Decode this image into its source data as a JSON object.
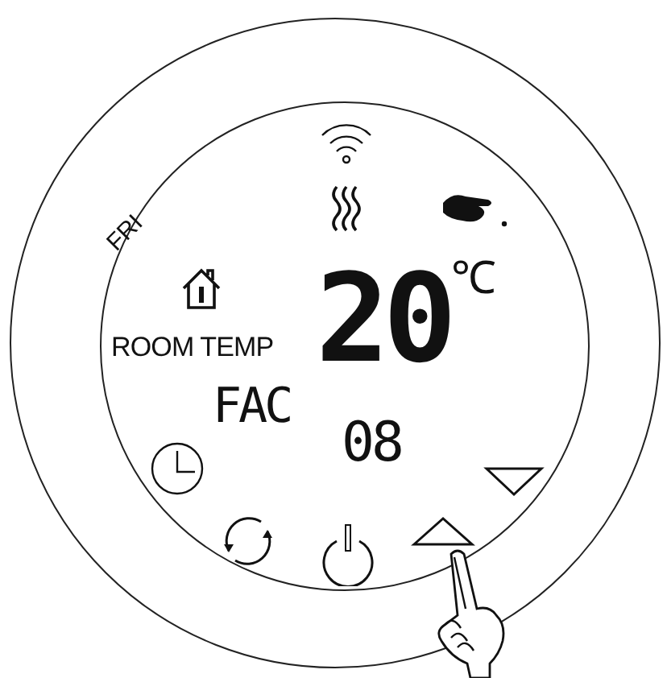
{
  "display": {
    "day": "FRI",
    "room_label": "ROOM TEMP",
    "temperature": "20",
    "unit": "℃",
    "mode": "FAC",
    "value": "08"
  }
}
